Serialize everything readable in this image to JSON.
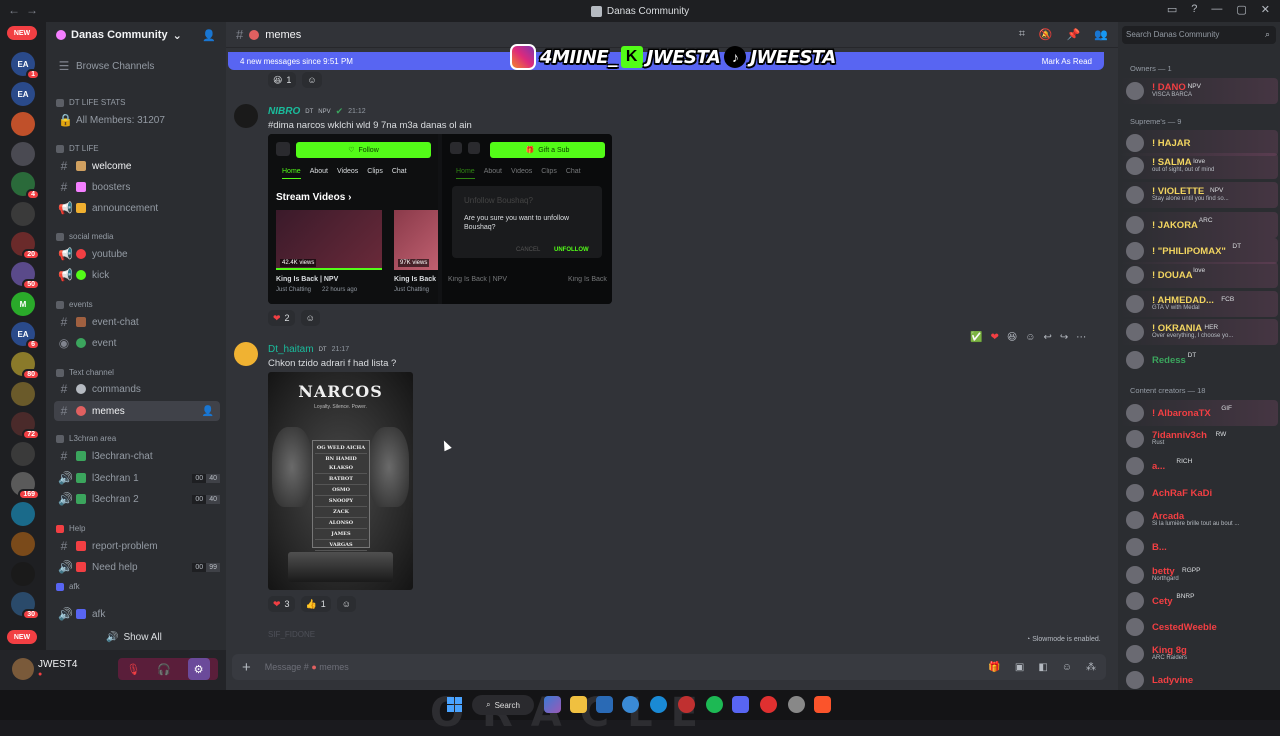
{
  "window": {
    "title": "Danas Community"
  },
  "servers": [
    {
      "initial": "",
      "color": "#1e1f22",
      "badge": "",
      "new": "NEW"
    },
    {
      "initial": "EA",
      "color": "#2a4a8a",
      "badge": "1"
    },
    {
      "initial": "EA",
      "color": "#2a4a8a",
      "badge": ""
    },
    {
      "initial": "",
      "color": "#c0502a",
      "badge": ""
    },
    {
      "initial": "",
      "color": "#4a4a52",
      "badge": ""
    },
    {
      "initial": "",
      "color": "#2a6a3a",
      "badge": "4"
    },
    {
      "initial": "",
      "color": "#3a3a3a",
      "badge": ""
    },
    {
      "initial": "",
      "color": "#6a2a2a",
      "badge": "20"
    },
    {
      "initial": "",
      "color": "#5a4a8a",
      "badge": "50"
    },
    {
      "initial": "M",
      "color": "#2aaa2a",
      "badge": ""
    },
    {
      "initial": "EA",
      "color": "#2a4a8a",
      "badge": "6"
    },
    {
      "initial": "",
      "color": "#8a7a2a",
      "badge": "80"
    },
    {
      "initial": "",
      "color": "#6a5a2a",
      "badge": ""
    },
    {
      "initial": "",
      "color": "#4a2a2a",
      "badge": "72"
    },
    {
      "initial": "",
      "color": "#3a3a3a",
      "badge": ""
    },
    {
      "initial": "",
      "color": "#5a5a5a",
      "badge": "169"
    },
    {
      "initial": "",
      "color": "#1a6a8a",
      "badge": ""
    },
    {
      "initial": "",
      "color": "#7a4a1a",
      "badge": ""
    },
    {
      "initial": "",
      "color": "#1a1a1a",
      "badge": ""
    },
    {
      "initial": "",
      "color": "#2a4a6a",
      "badge": "30"
    }
  ],
  "server_new_pill": "NEW",
  "guild": {
    "name": "Danas Community"
  },
  "channel_list": {
    "browse": "Browse Channels",
    "cat_stats": "DT LIFE STATS",
    "all_members": "All Members: 31207",
    "cat_dtlife": "DT LIFE",
    "welcome": "welcome",
    "boosters": "boosters",
    "announcement": "announcement",
    "cat_social": "social media",
    "youtube": "youtube",
    "kick": "kick",
    "cat_events": "events",
    "event_chat": "event-chat",
    "event": "event",
    "cat_text": "Text channel",
    "commands": "commands",
    "memes": "memes",
    "cat_l3": "L3chran area",
    "l3chat": "l3echran-chat",
    "l3_1": "l3echran 1",
    "l3_2": "l3echran 2",
    "l3_1_a": "00",
    "l3_1_b": "40",
    "l3_2_a": "00",
    "l3_2_b": "40",
    "cat_help": "Help",
    "report": "report-problem",
    "needhelp": "Need help",
    "need_a": "00",
    "need_b": "99",
    "cat_afk": "afk",
    "afk": "afk",
    "show_all": "Show All"
  },
  "user": {
    "name": "JWEST4"
  },
  "header": {
    "channel": "memes"
  },
  "banner": {
    "text": "4 new messages since 9:51 PM",
    "action": "Mark As Read"
  },
  "overlay": {
    "ig": "4MIINE_",
    "kick": "K",
    "kick_handle": "JWESTA",
    "tiktok": "JWEESTA"
  },
  "msgs": {
    "top_react": "1",
    "m1": {
      "author": "NIBRO",
      "tag": "DT",
      "role": "NPV",
      "time": "21:12",
      "text": "#dima narcos wklchi wld 9 7na m3a danas ol  ain",
      "embed": {
        "follow": "Follow",
        "gift": "Gift a Sub",
        "tabs": [
          "Home",
          "About",
          "Videos",
          "Clips",
          "Chat"
        ],
        "section": "Stream Videos",
        "v1_views": "42.4K views",
        "v2_views": "97K views",
        "v1_title": "King Is Back | NPV",
        "v2_title": "King Is Back",
        "v1_cat": "Just Chatting",
        "v1_ago": "22 hours ago",
        "v2_cat": "Just Chatting",
        "dialog_title": "Unfollow Boushaq?",
        "dialog_text": "Are you sure you want to unfollow Boushaq?",
        "cancel": "CANCEL",
        "unfollow": "UNFOLLOW"
      },
      "react": "2"
    },
    "m2": {
      "author": "Dt_haitam",
      "tag": "DT",
      "time": "21:17",
      "text": "Chkon tzido adrari f had lista ?",
      "poster": {
        "title": "NARCOS",
        "sub": "Loyalty. Silence. Power.",
        "names": [
          "OG WELD AICHA",
          "BN HAMID KLAKSO",
          "BATBOT",
          "OSMO",
          "SNOOPY",
          "ZACK",
          "ALONSO",
          "JAMES",
          "VARGAS",
          "..."
        ]
      },
      "react_heart": "3",
      "react_thumb": "1"
    },
    "ghost": "SIF_FIDONE"
  },
  "composer": {
    "placeholder": "Message #",
    "channel": "memes",
    "slowmode": "Slowmode is enabled."
  },
  "members": {
    "search": "Search Danas Community",
    "owners_hdr": "Owners — 1",
    "supremes_hdr": "Supreme's — 9",
    "creators_hdr": "Content creators — 18",
    "list": [
      {
        "name": "! DANO",
        "tag": "NPV",
        "sub": "VISCA BARCA",
        "color": "#f23f43"
      },
      {
        "name": "! HAJAR",
        "tag": "",
        "sub": "",
        "color": "#f2d560"
      },
      {
        "name": "! SALMA",
        "tag": "love",
        "sub": "out of sight, out of mind",
        "color": "#f2d560"
      },
      {
        "name": "! VIOLETTE",
        "tag": "NPV",
        "sub": "Stay alone until you find so...",
        "color": "#f2d560"
      },
      {
        "name": "! JAKORA",
        "tag": "ARC",
        "sub": "",
        "color": "#f2d560"
      },
      {
        "name": "! \"PHILIPOMAX\"",
        "tag": "DT",
        "sub": "",
        "color": "#f2d560"
      },
      {
        "name": "! DOUAA",
        "tag": "love",
        "sub": "",
        "color": "#f2d560"
      },
      {
        "name": "! AHMEDAD...",
        "tag": "FCB",
        "sub": "GTA V with Medal",
        "color": "#f2d560"
      },
      {
        "name": "! OKRANIA",
        "tag": "HER",
        "sub": "Over everything, I choose yo...",
        "color": "#f2d560"
      },
      {
        "name": "Redess",
        "tag": "DT",
        "sub": "",
        "color": "#3ba55d"
      },
      {
        "name": "! AlbaronaTX",
        "tag": "GIF",
        "sub": "",
        "color": "#f23f43"
      },
      {
        "name": "7idanniv3ch",
        "tag": "RW",
        "sub": "Rust",
        "color": "#f23f43"
      },
      {
        "name": "a...",
        "tag": "RICH",
        "sub": "",
        "color": "#f23f43"
      },
      {
        "name": "AchRaF KaDi",
        "tag": "",
        "sub": "",
        "color": "#f23f43"
      },
      {
        "name": "Arcada",
        "tag": "",
        "sub": "Si la lumière brille tout au bout ...",
        "color": "#f23f43"
      },
      {
        "name": "B...",
        "tag": "",
        "sub": "",
        "color": "#f23f43"
      },
      {
        "name": "betty",
        "tag": "RGPP",
        "sub": "Northgard",
        "color": "#f23f43"
      },
      {
        "name": "Cety",
        "tag": "BNRP",
        "sub": "",
        "color": "#f23f43"
      },
      {
        "name": "CestedWeeble",
        "tag": "",
        "sub": "",
        "color": "#f23f43"
      },
      {
        "name": "King 8g",
        "tag": "",
        "sub": "ARC Raiders",
        "color": "#f23f43"
      },
      {
        "name": "Ladyvine",
        "tag": "",
        "sub": "",
        "color": "#f23f43"
      }
    ]
  },
  "taskbar": {
    "search": "Search"
  }
}
